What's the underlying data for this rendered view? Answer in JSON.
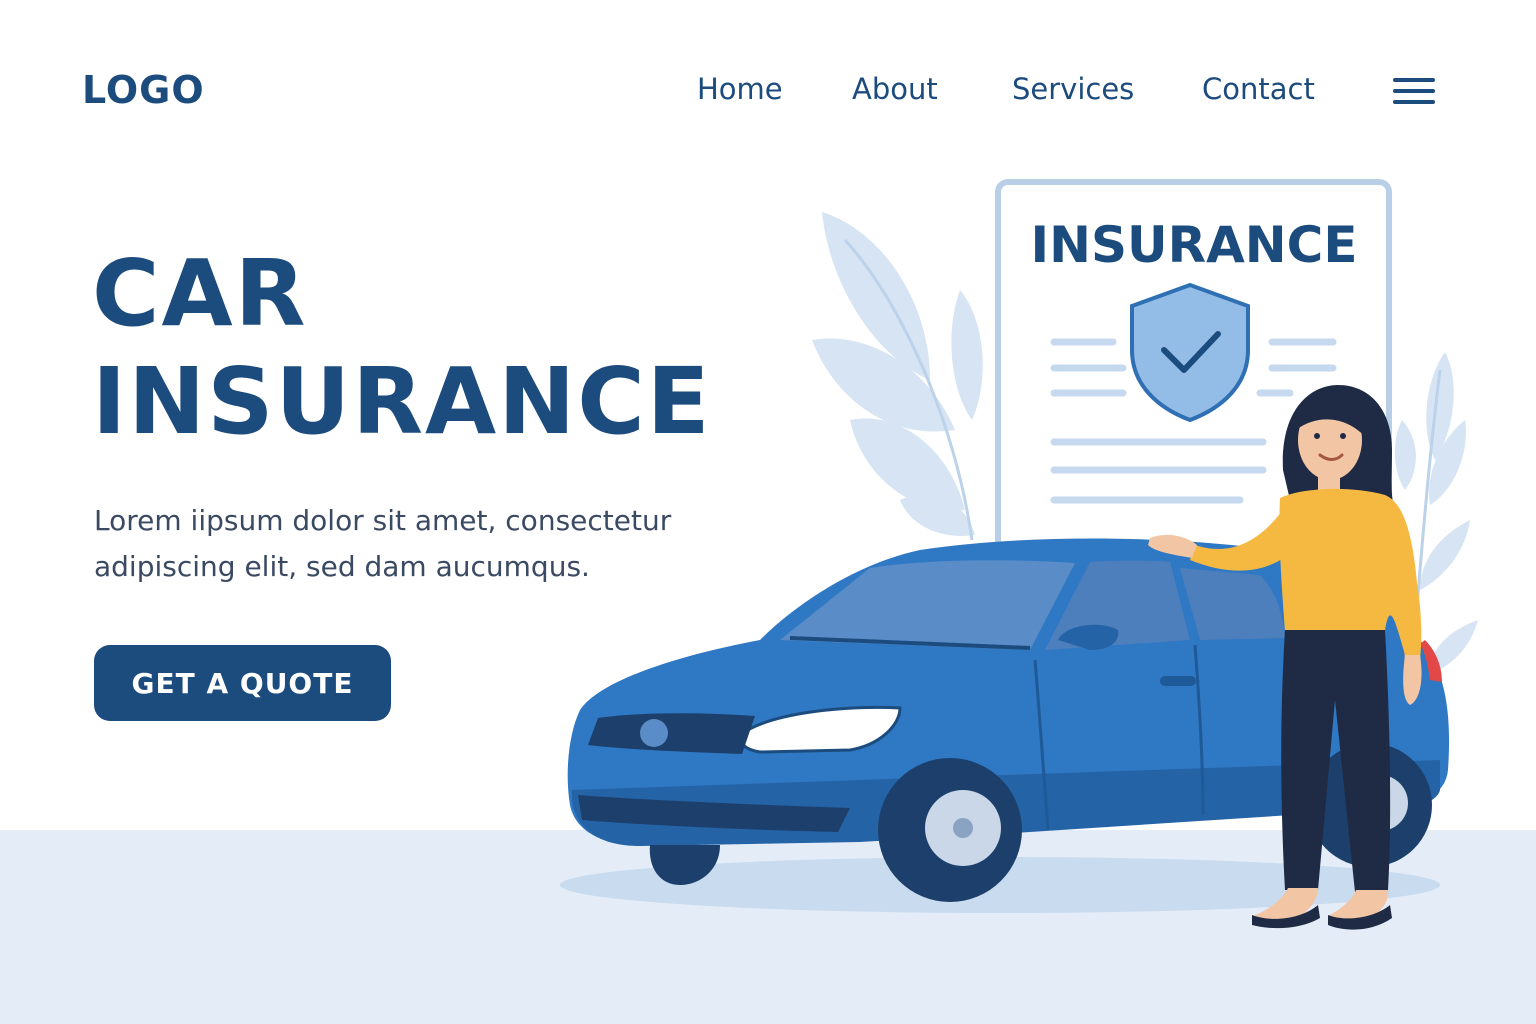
{
  "header": {
    "logo": "LOGO",
    "nav": [
      "Home",
      "About",
      "Services",
      "Contact"
    ]
  },
  "hero": {
    "title_line1": "CAR",
    "title_line2": "INSURANCE",
    "desc_line1": "Lorem iipsum dolor sit amet, consectetur",
    "desc_line2": "adipiscing elit, sed dam aucumqus.",
    "cta": "GET A QUOTE"
  },
  "illustration": {
    "document_title": "INSURANCE"
  },
  "colors": {
    "primary": "#1c4b7e",
    "car_blue": "#2f78c4",
    "shirt_yellow": "#f5b942",
    "ground": "#e4edf7",
    "leaf": "#d6e4f4"
  },
  "icons": [
    "menu-icon",
    "shield-check-icon"
  ]
}
